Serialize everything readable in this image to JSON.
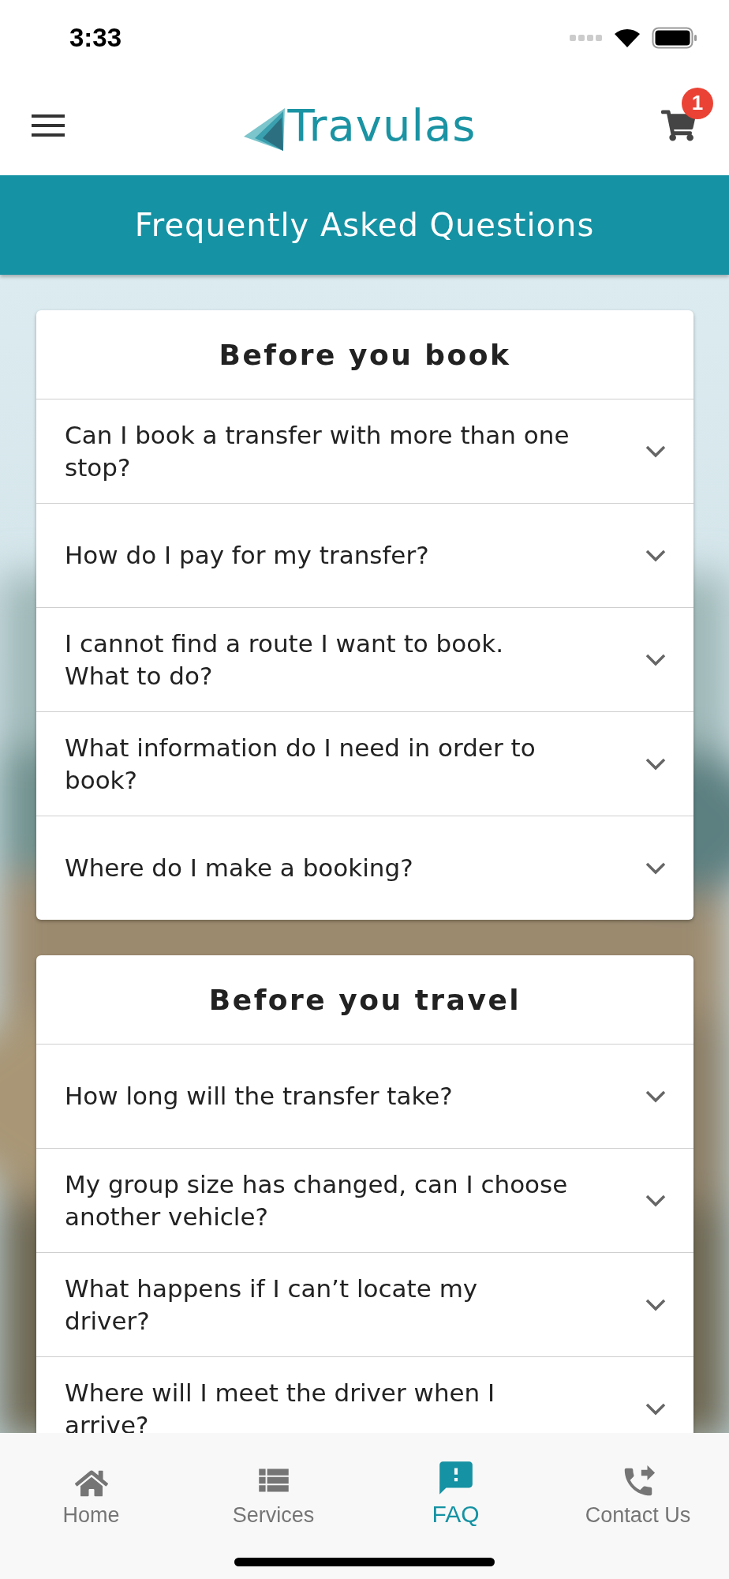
{
  "status_bar": {
    "time": "3:33"
  },
  "header": {
    "logo": "Travulas",
    "cart_count": "1"
  },
  "title_bar": {
    "title": "Frequently Asked Questions"
  },
  "sections": [
    {
      "title": "Before you book",
      "questions": [
        {
          "text": "Can I book a transfer with more than one stop?",
          "expanded": false
        },
        {
          "text": "How do I pay for my transfer?",
          "expanded": false
        },
        {
          "text": "I cannot find a route I want to book. What to do?",
          "expanded": false
        },
        {
          "text": "What information do I need in order to book?",
          "expanded": false
        },
        {
          "text": "Where do I make a booking?",
          "expanded": false
        }
      ]
    },
    {
      "title": "Before you travel",
      "questions": [
        {
          "text": "How long will the transfer take?",
          "expanded": false
        },
        {
          "text": "My group size has changed, can I choose another vehicle?",
          "expanded": false
        },
        {
          "text": "What happens if I can’t locate my driver?",
          "expanded": false
        },
        {
          "text": "Where will I meet the driver when I arrive?",
          "expanded": false
        }
      ]
    }
  ],
  "tab_bar": [
    {
      "kind": "home",
      "label": "Home",
      "selected": false
    },
    {
      "kind": "services",
      "label": "Services",
      "selected": false
    },
    {
      "kind": "faq",
      "label": "FAQ",
      "selected": true
    },
    {
      "kind": "contact",
      "label": "Contact Us",
      "selected": false
    }
  ]
}
